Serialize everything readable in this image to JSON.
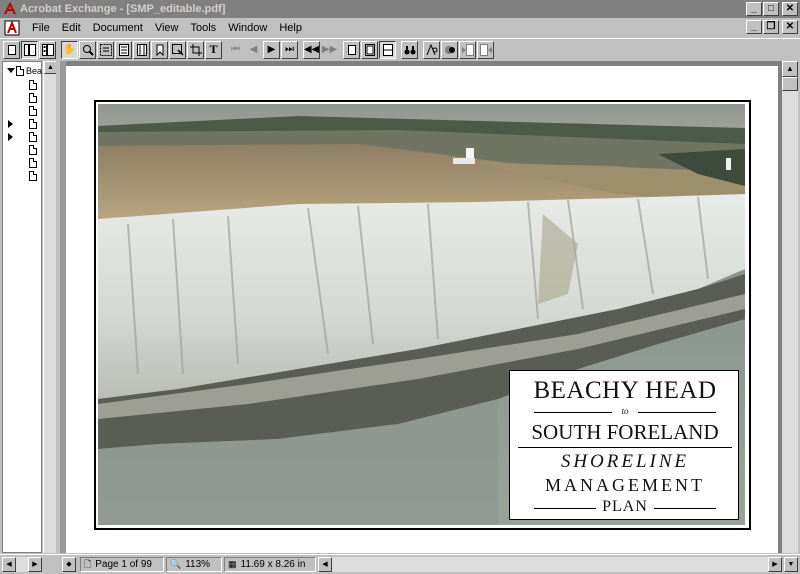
{
  "window": {
    "title": "Acrobat Exchange - [SMP_editable.pdf]",
    "minimize": "_",
    "maximize": "□",
    "close": "✕"
  },
  "menu": {
    "items": [
      {
        "label": "File"
      },
      {
        "label": "Edit"
      },
      {
        "label": "Document"
      },
      {
        "label": "View"
      },
      {
        "label": "Tools"
      },
      {
        "label": "Window"
      },
      {
        "label": "Help"
      }
    ],
    "doc_restore": "❐"
  },
  "toolbar": {
    "text_tool": "T"
  },
  "bookmarks": {
    "root_label": "Bea",
    "item_count": 8
  },
  "document": {
    "title_line1": "BEACHY HEAD",
    "title_to": "to",
    "title_line2": "SOUTH FORELAND",
    "title_line3": "SHORELINE",
    "title_line4": "MANAGEMENT",
    "title_line5": "PLAN"
  },
  "status": {
    "page": "Page 1 of 99",
    "zoom": "113%",
    "page_size": "11.69 x 8.26 in"
  }
}
